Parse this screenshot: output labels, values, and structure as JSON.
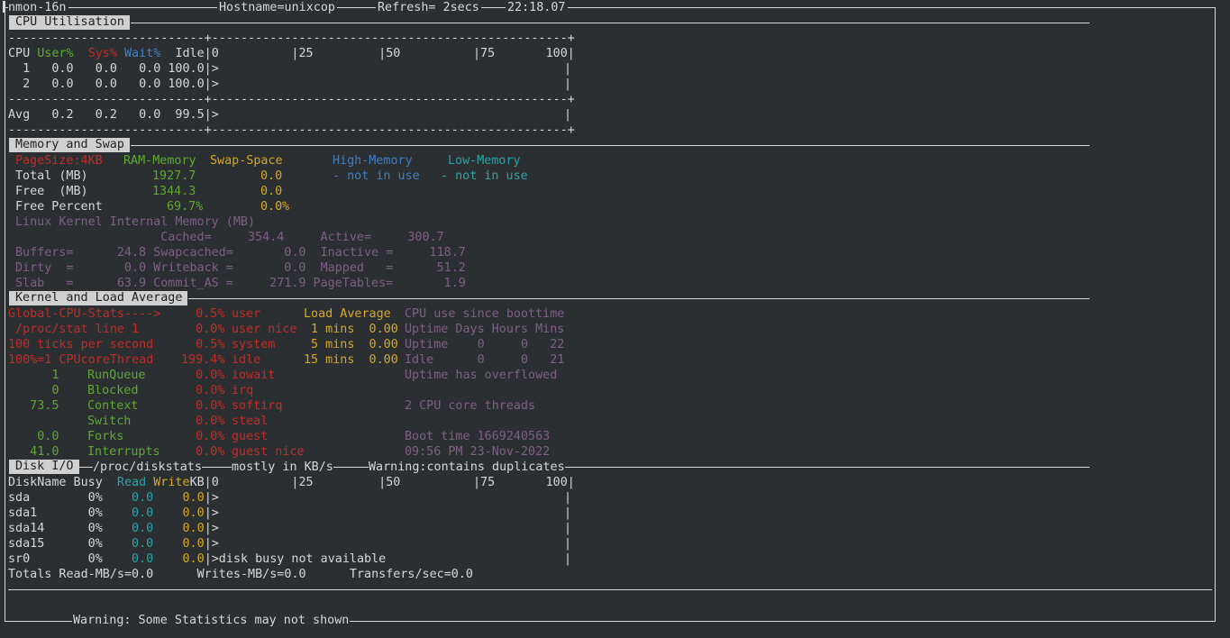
{
  "title_bar": {
    "app": "nmon-16n",
    "host": "Hostname=unixcop",
    "refresh": "Refresh= 2secs",
    "time": "22:18.07"
  },
  "colors": {
    "background": "#2b2f31",
    "text": "#d8d8d8",
    "green": "#5fa832",
    "red": "#c42b26",
    "blue": "#3f7fc6",
    "cyan": "#2ba3a8",
    "yellow": "#d6a823",
    "magenta": "#7f5f86"
  },
  "cpu": {
    "title": "CPU Utilisation",
    "divider": "---------------------------+-------------------------------------------------+",
    "header": {
      "cpu": "CPU",
      "user": "User%",
      "sys": "Sys%",
      "wait": "Wait%",
      "idle": "Idle|0          |25         |50          |75       100|"
    },
    "rows": [
      {
        "text": "  1   0.0   0.0   0.0 100.0|>",
        "end": "|"
      },
      {
        "text": "  2   0.0   0.0   0.0 100.0|>",
        "end": "|"
      }
    ],
    "avg": {
      "text": "Avg   0.2   0.2   0.0  99.5|>",
      "end": "|"
    }
  },
  "memory": {
    "title": "Memory and Swap",
    "pagesize": "PageSize:4KB",
    "ram": "RAM-Memory",
    "swap": "Swap-Space",
    "high": "High-Memory",
    "low": "Low-Memory",
    "total_label": "Total (MB)",
    "total_ram": "1927.7",
    "total_swap": "0.0",
    "high_val": "- not in use",
    "low_val": "- not in use",
    "free_label": "Free  (MB)",
    "free_ram": "1344.3",
    "free_swap": "0.0",
    "pct_label": "Free Percent",
    "pct_ram": "69.7%",
    "pct_swap": "0.0%",
    "kernel_lines": [
      "Linux Kernel Internal Memory (MB)",
      "                    Cached=     354.4     Active=     300.7",
      "Buffers=      24.8 Swapcached=       0.0  Inactive =     118.7",
      "Dirty  =       0.0 Writeback =       0.0  Mapped   =      51.2",
      "Slab   =      63.9 Commit_AS =     271.9 PageTables=       1.9"
    ]
  },
  "kernel": {
    "title": "Kernel and Load Average",
    "left": [
      "Global-CPU-Stats---->",
      " /proc/stat line 1",
      "100 ticks per second",
      "100%=1 CPUcoreThread"
    ],
    "counters": [
      {
        "num": "      1",
        "label": "RunQueue"
      },
      {
        "num": "      0",
        "label": "Blocked"
      },
      {
        "num": "   73.5",
        "label": "Context"
      },
      {
        "num": "",
        "label": "Switch"
      },
      {
        "num": "    0.0",
        "label": "Forks"
      },
      {
        "num": "   41.0",
        "label": "Interrupts"
      }
    ],
    "cpu_pct": [
      "  0.5%",
      "  0.0%",
      "  0.5%",
      "199.4%",
      "  0.0%",
      "  0.0%",
      "  0.0%",
      "  0.0%",
      "  0.0%",
      "  0.0%"
    ],
    "cpu_names": [
      "user",
      "user nice",
      "system",
      "idle",
      "iowait",
      "irq",
      "softirq",
      "steal",
      "guest",
      "guest nice"
    ],
    "load_title": "Load Average",
    "load_rows": [
      " 1 mins  0.00",
      " 5 mins  0.00",
      "15 mins  0.00"
    ],
    "right": [
      "CPU use since boottime",
      "Uptime Days Hours Mins",
      "Uptime    0     0   22",
      "Idle      0     0   21",
      "Uptime has overflowed",
      "",
      "2 CPU core threads",
      "",
      "Boot time 1669240563",
      "09:56 PM 23-Nov-2022"
    ]
  },
  "disk": {
    "title": "Disk I/O",
    "subtitle_a": "/proc/diskstats",
    "subtitle_b": "mostly in KB/s",
    "subtitle_c": "Warning:contains duplicates",
    "header": {
      "a": "DiskName Busy ",
      "read": " Read",
      "write": " Write",
      "b": "KB|0          |25         |50          |75       100|"
    },
    "rows": [
      {
        "name": "sda        0%  ",
        "read": "  0.0",
        "write": "    0.0",
        "bar": "|>",
        "end": "|"
      },
      {
        "name": "sda1       0%  ",
        "read": "  0.0",
        "write": "    0.0",
        "bar": "|>",
        "end": "|"
      },
      {
        "name": "sda14      0%  ",
        "read": "  0.0",
        "write": "    0.0",
        "bar": "|>",
        "end": "|"
      },
      {
        "name": "sda15      0%  ",
        "read": "  0.0",
        "write": "    0.0",
        "bar": "|>",
        "end": "|"
      },
      {
        "name": "sr0        0%  ",
        "read": "  0.0",
        "write": "    0.0",
        "bar": "|>disk busy not available",
        "end": "|"
      }
    ],
    "totals": "Totals Read-MB/s=0.0      Writes-MB/s=0.0      Transfers/sec=0.0"
  },
  "footer": {
    "warning": "Warning: Some Statistics may not shown"
  }
}
